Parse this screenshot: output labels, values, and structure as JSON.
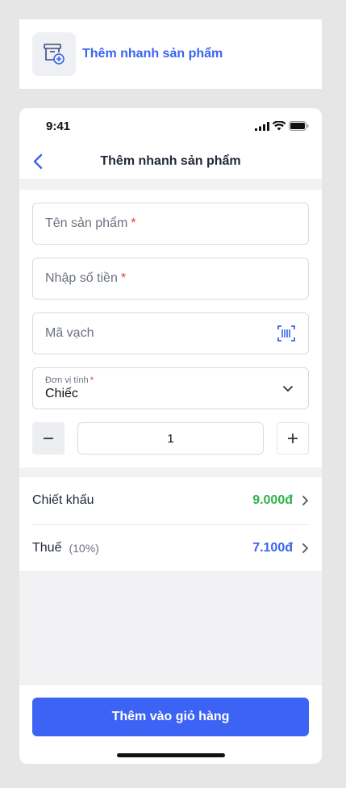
{
  "shortcut": {
    "title": "Thêm nhanh sản phẩm",
    "icon": "add-product-icon"
  },
  "status_bar": {
    "time": "9:41"
  },
  "nav": {
    "title": "Thêm nhanh sản phẩm"
  },
  "form": {
    "name": {
      "placeholder": "Tên sản phẩm",
      "required": "*"
    },
    "price": {
      "placeholder": "Nhập số tiền",
      "required": "*"
    },
    "barcode": {
      "placeholder": "Mã vạch"
    },
    "unit": {
      "label": "Đơn vị tính",
      "required": "*",
      "value": "Chiếc"
    },
    "quantity": {
      "value": "1"
    }
  },
  "list": {
    "discount": {
      "label": "Chiết khấu",
      "value": "9.000đ",
      "color": "#2fb24a"
    },
    "tax": {
      "label": "Thuế",
      "sub": "(10%)",
      "value": "7.100đ",
      "color": "#3b63f0"
    }
  },
  "cta": {
    "label": "Thêm vào giỏ hàng",
    "color": "#3d63f5"
  }
}
